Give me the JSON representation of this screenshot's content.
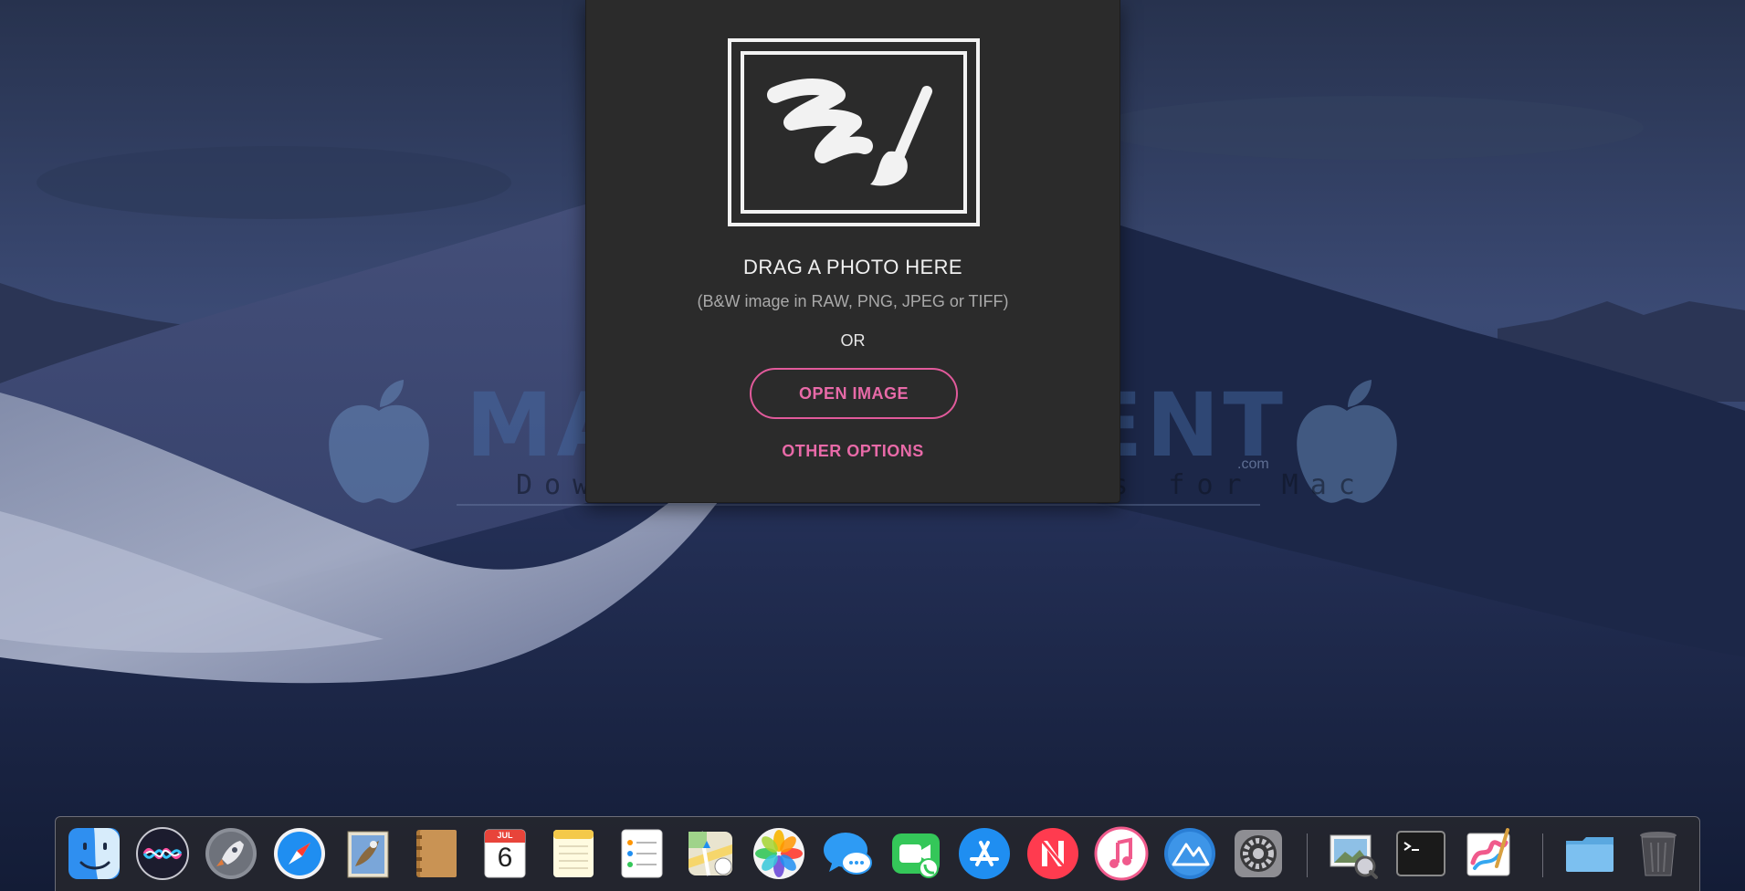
{
  "drop_panel": {
    "title": "DRAG A PHOTO HERE",
    "subtitle": "(B&W image in RAW, PNG, JPEG or TIFF)",
    "separator": "OR",
    "open_button_label": "OPEN IMAGE",
    "other_options_label": "OTHER OPTIONS",
    "accent_color": "#e15a9b",
    "icon": "frame-brush-icon"
  },
  "watermark": {
    "title": "MACS TORRENT",
    "dotcom": ".com",
    "subtitle": "Download Free Torrents for Mac"
  },
  "dock": {
    "calendar": {
      "month": "JUL",
      "day": "6"
    },
    "items": [
      {
        "name": "Finder",
        "icon": "finder-icon"
      },
      {
        "name": "Siri",
        "icon": "siri-icon"
      },
      {
        "name": "Launchpad",
        "icon": "launchpad-icon"
      },
      {
        "name": "Safari",
        "icon": "safari-icon"
      },
      {
        "name": "Mail",
        "icon": "mail-icon"
      },
      {
        "name": "Contacts",
        "icon": "contacts-icon"
      },
      {
        "name": "Calendar",
        "icon": "calendar-icon"
      },
      {
        "name": "Notes",
        "icon": "notes-icon"
      },
      {
        "name": "Reminders",
        "icon": "reminders-icon"
      },
      {
        "name": "Maps",
        "icon": "maps-icon"
      },
      {
        "name": "Photos",
        "icon": "photos-icon"
      },
      {
        "name": "Messages",
        "icon": "messages-icon"
      },
      {
        "name": "FaceTime",
        "icon": "facetime-icon"
      },
      {
        "name": "App Store",
        "icon": "app-store-icon"
      },
      {
        "name": "News",
        "icon": "news-icon"
      },
      {
        "name": "iTunes",
        "icon": "itunes-icon"
      },
      {
        "name": "Mountain Duck",
        "icon": "mountain-icon"
      },
      {
        "name": "System Preferences",
        "icon": "system-preferences-icon"
      },
      {
        "name": "Preview",
        "icon": "preview-icon"
      },
      {
        "name": "Terminal",
        "icon": "terminal-icon"
      },
      {
        "name": "Paint app",
        "icon": "paint-app-icon"
      },
      {
        "name": "Downloads",
        "icon": "folder-icon"
      },
      {
        "name": "Trash",
        "icon": "trash-icon"
      }
    ]
  }
}
